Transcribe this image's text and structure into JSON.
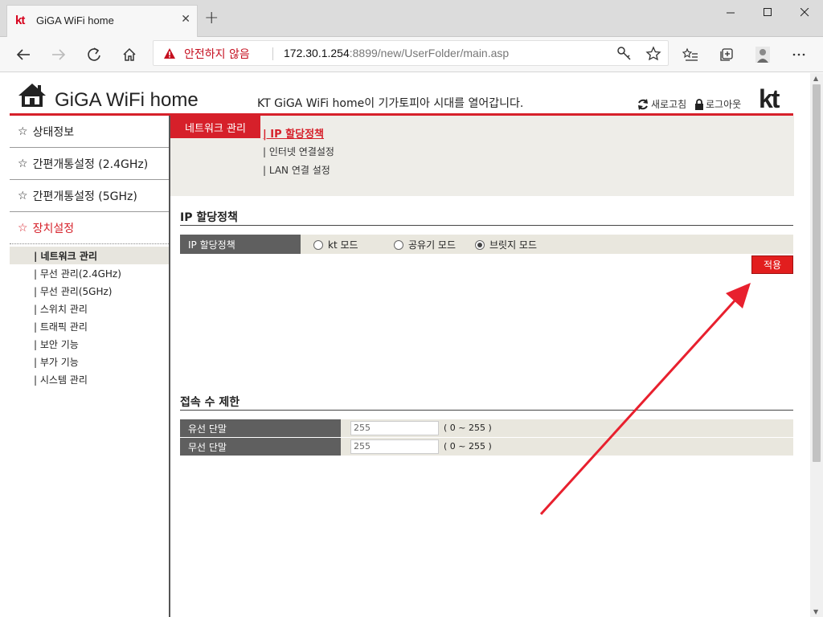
{
  "browser": {
    "tab_favicon": "kt",
    "tab_title": "GiGA WiFi home",
    "tab_close": "✕",
    "new_tab": "+",
    "security_warning": "안전하지 않음",
    "url_host": "172.30.1.254",
    "url_rest": ":8899/new/UserFolder/main.asp"
  },
  "header": {
    "site_title": "GiGA WiFi home",
    "slogan": "KT GiGA WiFi home이 기가토피아 시대를 열어갑니다.",
    "refresh_label": "새로고침",
    "logout_label": "로그아웃",
    "brand_logo": "kt"
  },
  "sidebar": {
    "star": "☆",
    "items": [
      {
        "label": "상태정보"
      },
      {
        "label": "간편개통설정 (2.4GHz)"
      },
      {
        "label": "간편개통설정 (5GHz)"
      },
      {
        "label": "장치설정"
      }
    ],
    "subitems": [
      {
        "label": "| 네트워크 관리"
      },
      {
        "label": "| 무선 관리(2.4GHz)"
      },
      {
        "label": "| 무선 관리(5GHz)"
      },
      {
        "label": "| 스위치 관리"
      },
      {
        "label": "| 트래픽 관리"
      },
      {
        "label": "| 보안 기능"
      },
      {
        "label": "| 부가 기능"
      },
      {
        "label": "| 시스템 관리"
      }
    ]
  },
  "tabs": {
    "active": "네트워크 관리",
    "subtabs": [
      {
        "label": "| IP 할당정책"
      },
      {
        "label": "| 인터넷 연결설정"
      },
      {
        "label": "| LAN 연결 설정"
      }
    ]
  },
  "ip_policy": {
    "title": "IP 할당정책",
    "row_label": "IP 할당정책",
    "options": [
      {
        "label": "kt 모드",
        "checked": false
      },
      {
        "label": "공유기 모드",
        "checked": false
      },
      {
        "label": "브릿지 모드",
        "checked": true
      }
    ],
    "apply_label": "적용"
  },
  "connection_limit": {
    "title": "접속 수 제한",
    "rows": [
      {
        "label": "유선 단말",
        "value": "255",
        "range": "( 0 ~ 255 )"
      },
      {
        "label": "무선 단말",
        "value": "255",
        "range": "( 0 ~ 255 )"
      }
    ]
  },
  "colors": {
    "accent": "#d6202a",
    "annotation_arrow": "#e8202e"
  }
}
